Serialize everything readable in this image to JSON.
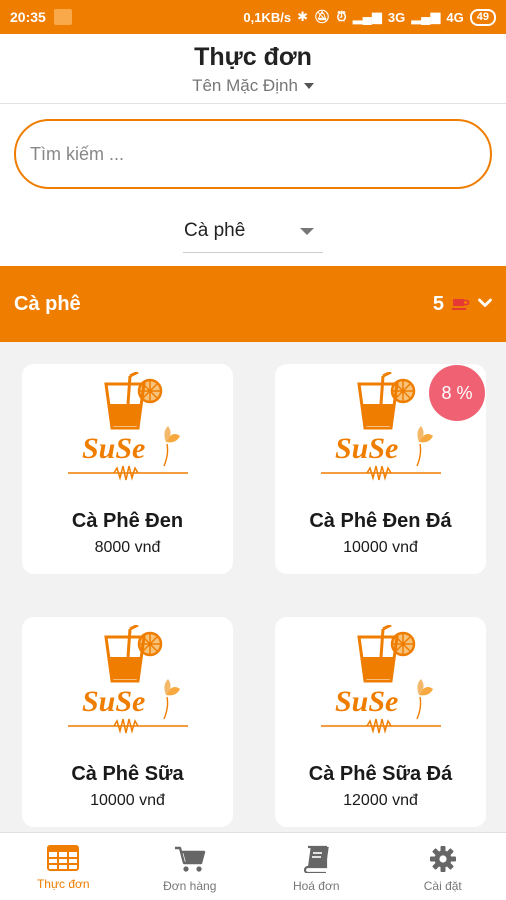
{
  "status_bar": {
    "time": "20:35",
    "network_speed": "0,1KB/s",
    "network_type": "3G",
    "network_type_2": "4G",
    "battery": "49"
  },
  "header": {
    "title": "Thực đơn",
    "store_name": "Tên Mặc Định"
  },
  "search": {
    "placeholder": "Tìm kiếm ..."
  },
  "category_dropdown": {
    "selected": "Cà phê"
  },
  "category_bar": {
    "name": "Cà phê",
    "count": "5"
  },
  "products": [
    {
      "name": "Cà Phê Đen",
      "price": "8000 vnđ",
      "logo_text": "SuSe"
    },
    {
      "name": "Cà Phê Đen Đá",
      "price": "10000 vnđ",
      "logo_text": "SuSe",
      "discount": "8 %"
    },
    {
      "name": "Cà Phê Sữa",
      "price": "10000 vnđ",
      "logo_text": "SuSe"
    },
    {
      "name": "Cà Phê Sữa Đá",
      "price": "12000 vnđ",
      "logo_text": "SuSe"
    }
  ],
  "bottom_nav": [
    {
      "label": "Thực đơn",
      "icon": "grid-icon",
      "active": true
    },
    {
      "label": "Đơn hàng",
      "icon": "cart-icon"
    },
    {
      "label": "Hoá đơn",
      "icon": "book-icon"
    },
    {
      "label": "Cài đặt",
      "icon": "gear-icon"
    }
  ],
  "colors": {
    "accent": "#ef7d00",
    "discount_badge": "#f06273",
    "background": "#f2f2f2"
  }
}
